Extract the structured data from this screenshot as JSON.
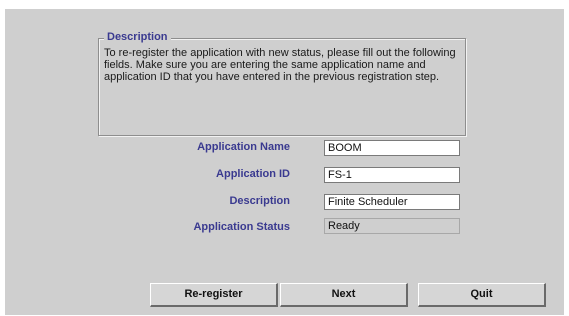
{
  "description_group": {
    "legend": "Description",
    "text": "To re-register the application with new status, please fill out the following fields. Make sure you are entering the same application name and application ID that you have entered in the previous registration step."
  },
  "form": {
    "app_name_label": "Application Name",
    "app_name_value": "BOOM",
    "app_id_label": "Application ID",
    "app_id_value": "FS-1",
    "description_label": "Description",
    "description_value": "Finite Scheduler",
    "status_label": "Application Status",
    "status_value": "Ready"
  },
  "buttons": {
    "reregister": "Re-register",
    "next": "Next",
    "quit": "Quit"
  }
}
